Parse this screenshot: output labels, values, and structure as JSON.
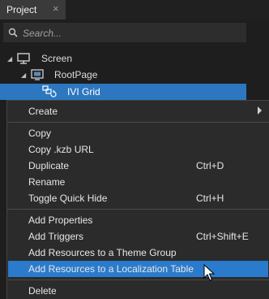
{
  "panel": {
    "tab_title": "Project",
    "tab_close": "×"
  },
  "search": {
    "placeholder": "Search..."
  },
  "tree": [
    {
      "label": "Screen",
      "expanded": true,
      "icon": "monitor-icon"
    },
    {
      "label": "RootPage",
      "expanded": true,
      "icon": "page-icon"
    },
    {
      "label": "IVI Grid",
      "selected": true,
      "icon": "grid-layout-icon"
    }
  ],
  "context_menu": {
    "create": {
      "label": "Create",
      "has_submenu": true
    },
    "copy": {
      "label": "Copy"
    },
    "copy_kzb_url": {
      "label": "Copy .kzb URL"
    },
    "duplicate": {
      "label": "Duplicate",
      "shortcut": "Ctrl+D"
    },
    "rename": {
      "label": "Rename"
    },
    "toggle_quick_hide": {
      "label": "Toggle Quick Hide",
      "shortcut": "Ctrl+H"
    },
    "add_properties": {
      "label": "Add Properties"
    },
    "add_triggers": {
      "label": "Add Triggers",
      "shortcut": "Ctrl+Shift+E"
    },
    "add_resources_theme": {
      "label": "Add Resources to a Theme Group"
    },
    "add_resources_localization": {
      "label": "Add Resources to a Localization Table",
      "highlighted": true
    },
    "delete": {
      "label": "Delete"
    }
  },
  "colors": {
    "selection": "#2d77c0",
    "highlight": "#2a7bcc",
    "menu_bg": "#2b2b2b",
    "panel_bg": "#1e1e1e"
  }
}
